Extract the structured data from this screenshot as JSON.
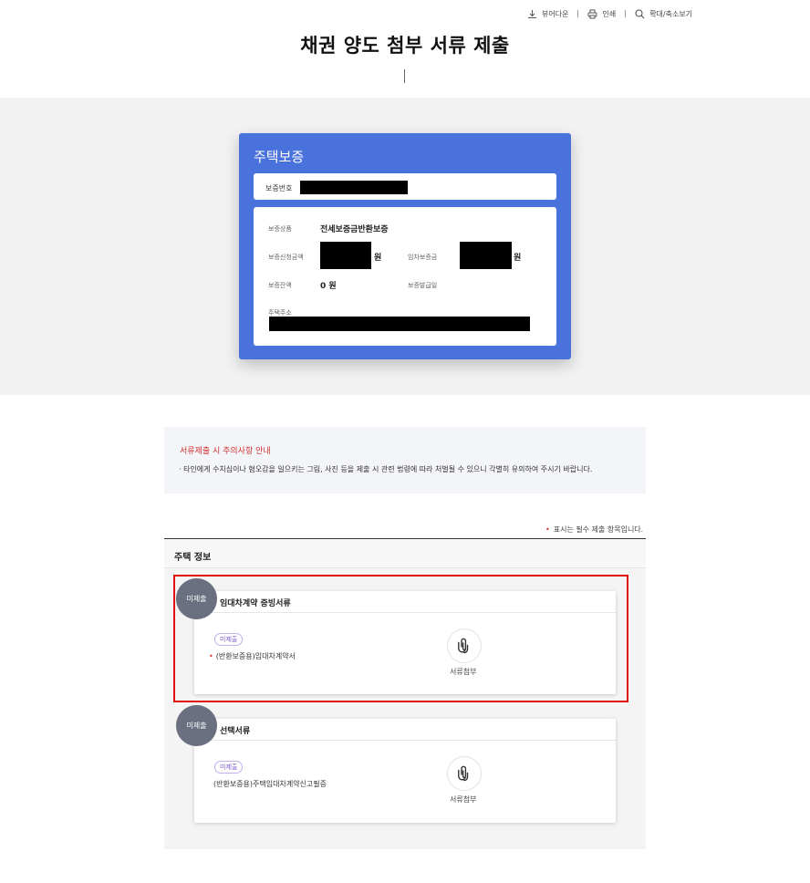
{
  "toolbar": {
    "viewer_download": "뷰어다운",
    "print": "인쇄",
    "zoom": "확대/축소보기"
  },
  "page_title": "채권 양도 첨부 서류 제출",
  "guarantee_card": {
    "title": "주택보증",
    "number_label": "보증번호",
    "product_label": "보증상품",
    "product_value": "전세보증금반환보증",
    "apply_amount_label": "보증신청금액",
    "apply_amount_unit": "원",
    "deposit_label": "임차보증금",
    "deposit_unit": "원",
    "balance_label": "보증잔액",
    "balance_value": "0 원",
    "issue_date_label": "보증발급일",
    "address_label": "주택주소"
  },
  "notice": {
    "title": "서류제출 시 주의사항 안내",
    "text": "· 타인에게 수치심이나 혐오감을 일으키는 그림, 사진 등을 제출 시 관련 법령에 따라 처벌될 수 있으니 각별히 유의하여 주시기 바랍니다."
  },
  "required_note": "표시는 필수 제출 항목입니다.",
  "required_mark": "•",
  "section": {
    "title": "주택 정보",
    "docs": [
      {
        "status": "미제출",
        "title": "임대차계약 증빙서류",
        "pill": "미제출",
        "required": true,
        "name": "(반환보증용)임대차계약서",
        "attach_label": "서류첨부"
      },
      {
        "status": "미제출",
        "title": "선택서류",
        "pill": "미제출",
        "required": false,
        "name": "(반환보증용)주택임대차계약신고필증",
        "attach_label": "서류첨부"
      }
    ]
  },
  "colors": {
    "card_blue": "#4a72dc",
    "required_red": "#d03030",
    "highlight_red": "#e01010",
    "badge_gray": "#6a7080",
    "pill_purple": "#7a5bd0"
  }
}
